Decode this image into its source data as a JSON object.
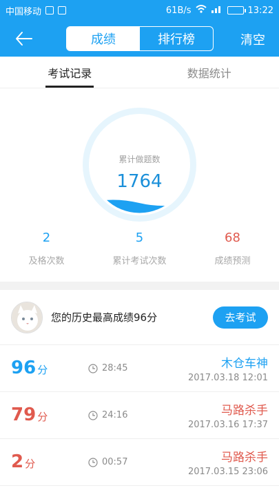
{
  "status_bar": {
    "carrier": "中国移动",
    "speed": "61B/s",
    "time": "13:22"
  },
  "header": {
    "segments": [
      "成绩",
      "排行榜"
    ],
    "active_segment": 0,
    "clear_label": "清空"
  },
  "tabs": [
    {
      "label": "考试记录",
      "active": true
    },
    {
      "label": "数据统计",
      "active": false
    }
  ],
  "gauge": {
    "label": "累计做题数",
    "count": "1764"
  },
  "stats": [
    {
      "value": "2",
      "label": "及格次数"
    },
    {
      "value": "5",
      "label": "累计考试次数"
    },
    {
      "value": "68",
      "label": "成绩预测"
    }
  ],
  "best": {
    "text": "您的历史最高成绩96分",
    "button_label": "去考试"
  },
  "records": [
    {
      "score": "96",
      "unit": "分",
      "duration": "28:45",
      "title": "木仓车神",
      "date": "2017.03.18  12:01",
      "color": "blue"
    },
    {
      "score": "79",
      "unit": "分",
      "duration": "24:16",
      "title": "马路杀手",
      "date": "2017.03.16  17:37",
      "color": "red"
    },
    {
      "score": "2",
      "unit": "分",
      "duration": "00:57",
      "title": "马路杀手",
      "date": "2017.03.15  23:06",
      "color": "red"
    }
  ],
  "colors": {
    "brand": "#1da1f2",
    "danger": "#e05a4e",
    "gauge_fill": "#1da1f2",
    "gauge_ring": "#e6f5fd"
  }
}
